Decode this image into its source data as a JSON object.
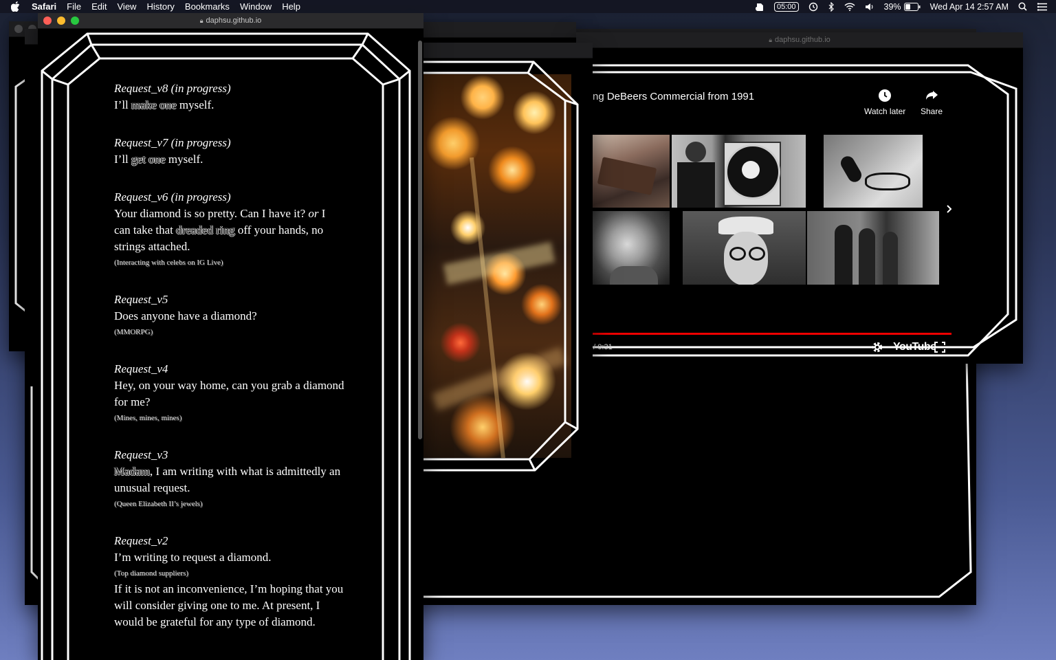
{
  "menubar": {
    "app": "Safari",
    "items": [
      "File",
      "Edit",
      "View",
      "History",
      "Bookmarks",
      "Window",
      "Help"
    ],
    "timer": "05:00",
    "battery": "39%",
    "datetime": "Wed Apr 14  2:57 AM"
  },
  "front_window": {
    "url": "daphsu.github.io",
    "entries": [
      {
        "head": "Request_v8 (in progress)",
        "parts": [
          {
            "t": "I’ll "
          },
          {
            "t": "make one",
            "ghost": true
          },
          {
            "t": " myself."
          }
        ]
      },
      {
        "head": "Request_v7 (in progress)",
        "parts": [
          {
            "t": "I’ll "
          },
          {
            "t": "get one",
            "ghost": true
          },
          {
            "t": " myself."
          }
        ]
      },
      {
        "head": "Request_v6 (in progress)",
        "parts": [
          {
            "t": "Your diamond is so pretty. Can I have it? "
          },
          {
            "t": "or",
            "italic": true
          },
          {
            "t": " I can take that "
          },
          {
            "t": "dreaded ring",
            "ghost": true
          },
          {
            "t": " off your hands, no strings attached."
          }
        ],
        "note": "(Interacting with celebs on IG Live)"
      },
      {
        "head": "Request_v5",
        "parts": [
          {
            "t": "Does anyone have a diamond?"
          }
        ],
        "note": "(MMORPG)"
      },
      {
        "head": "Request_v4",
        "parts": [
          {
            "t": "Hey, on your way home, can you grab a diamond for me?"
          }
        ],
        "note": "(Mines, mines, mines)"
      },
      {
        "head": "Request_v3",
        "parts": [
          {
            "t": "Madam",
            "ghost": true
          },
          {
            "t": ", I am writing with what is admittedly an unusual request."
          }
        ],
        "note": "(Queen Elizabeth II’s jewels)"
      },
      {
        "head": "Request_v2",
        "parts": [
          {
            "t": "I’m writing to request a diamond."
          }
        ],
        "note": "(Top diamond suppliers)",
        "extra": "If it is not an inconvenience, I’m hoping that you will consider giving one to me. At present, I would be grateful for any type of diamond."
      }
    ]
  },
  "video_window": {
    "url": "daphsu.github.io",
    "title": "ng DeBeers Commercial from 1991",
    "watch_later": "Watch later",
    "share": "Share",
    "time": "0 / 0:31",
    "logo": "YouTube",
    "icons": [
      "clock-icon",
      "share-icon",
      "chevron-right-icon",
      "gear-icon",
      "fullscreen-icon"
    ]
  }
}
